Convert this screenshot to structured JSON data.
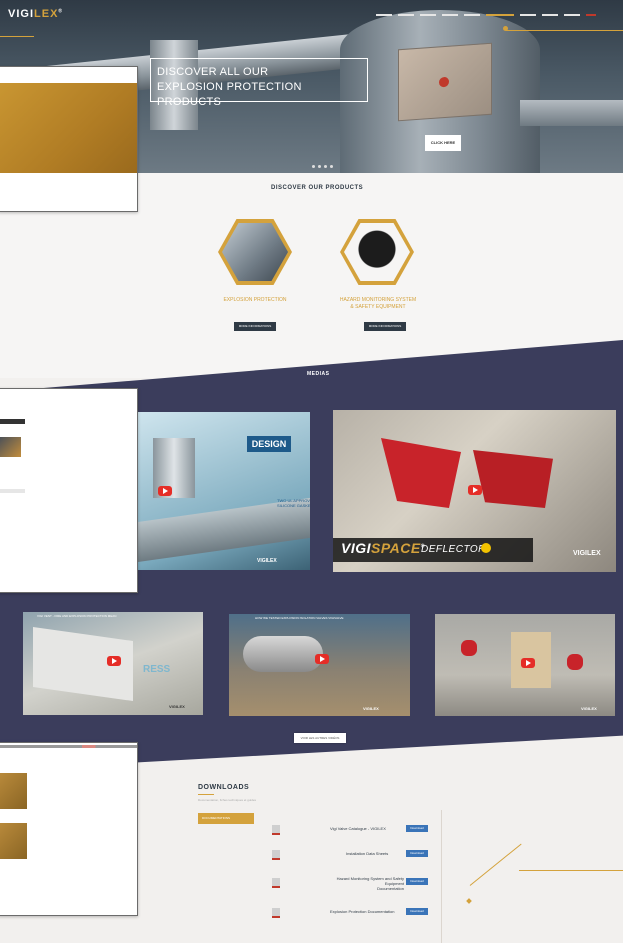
{
  "hero": {
    "logo_main": "VIGI",
    "logo_x": "LEX",
    "logo_sup": "®",
    "title_line1": "DISCOVER ALL OUR",
    "title_line2": "EXPLOSION PROTECTION PRODUCTS",
    "click_label": "CLICK HERE"
  },
  "products": {
    "title": "DISCOVER OUR PRODUCTS",
    "items": [
      {
        "label": "EXPLOSION PROTECTION",
        "button": "MORE INFORMATIONS"
      },
      {
        "label_line1": "HAZARD MONITORING SYSTEM",
        "label_line2": "& SAFETY EQUIPMENT",
        "button": "MORE INFORMATIONS"
      }
    ]
  },
  "medias": {
    "title": "MEDIAS",
    "video1": {
      "badge": "DESIGN",
      "annotation": "TWO UL APPROVED SILICONE GASKET",
      "brand": "VIGILEX"
    },
    "video2": {
      "brand_vigi": "VIGI",
      "brand_space": "SPACE",
      "brand_reg": "®",
      "product": "DEFLECTOR",
      "logo": "VIGILEX"
    },
    "video3": {
      "title": "VIGI VENT - FIRE AND EXPLOSION PROTECTION MEAN",
      "text": "RESS",
      "brand": "VIGILEX"
    },
    "video4": {
      "title": "HOW WE TESTED EXPLOSION ISOLATION VALVES VIGIVALVE",
      "brand": "VIGILEX"
    },
    "video5": {
      "brand": "VIGILEX"
    },
    "see_more": "VOIR LES AUTRES VIDÉOS"
  },
  "downloads": {
    "title": "DOWNLOADS",
    "subtitle": "Documentation, fiches techniques et guides",
    "side_active": "DOCUMENTATIONS",
    "items": [
      {
        "label": "Vigi Valve Catalogue - VIGILEX",
        "button": "Download"
      },
      {
        "label": "Installation Data Sheets",
        "button": "Download"
      },
      {
        "label_line1": "Hazard Monitoring System and Safety Equipment",
        "label_line2": "Documentation",
        "button": "Download"
      },
      {
        "label": "Explosion Protection Documentation",
        "button": "Download"
      }
    ]
  },
  "colors": {
    "accent": "#d4a23c",
    "navy": "#3b3d5c",
    "dark": "#2f3a45",
    "link": "#3a74b8"
  }
}
